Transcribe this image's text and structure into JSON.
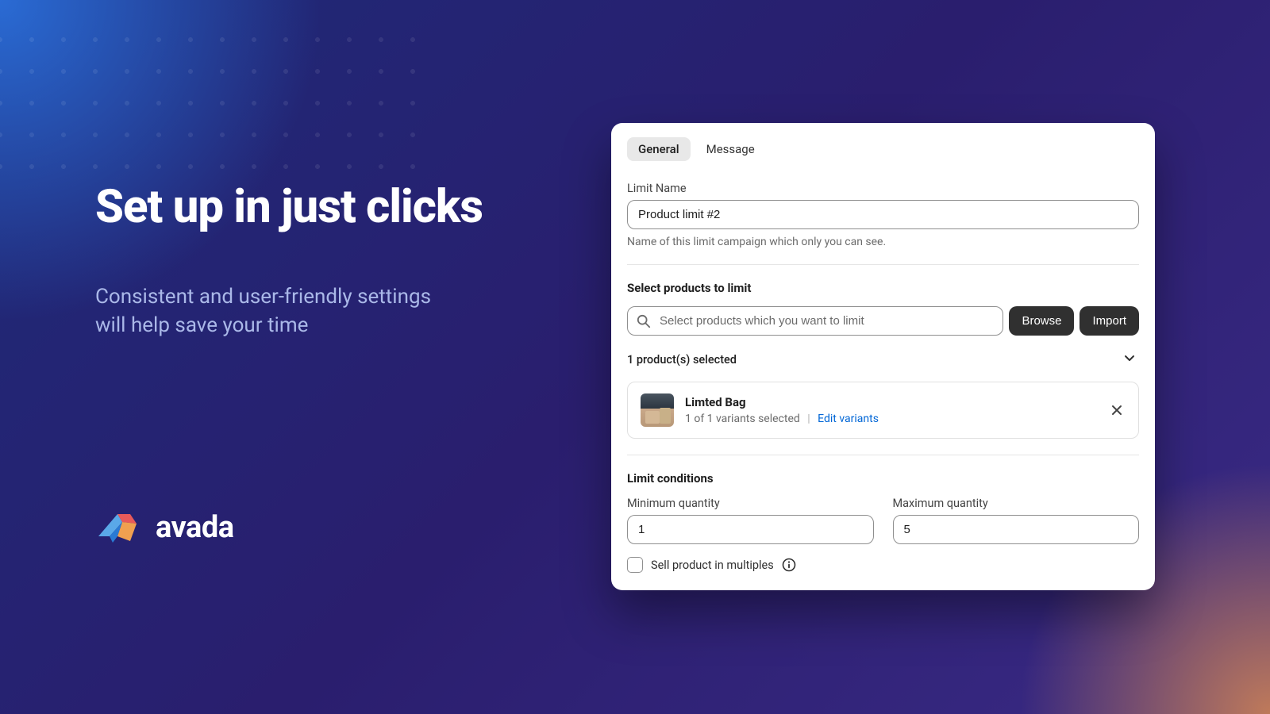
{
  "hero": {
    "title": "Set up in just clicks",
    "subtitle_line1": "Consistent and user-friendly settings",
    "subtitle_line2": "will help save your time"
  },
  "brand": {
    "name": "avada"
  },
  "card": {
    "tabs": {
      "general": "General",
      "message": "Message"
    },
    "limit_name": {
      "label": "Limit Name",
      "value": "Product limit #2",
      "help": "Name of this limit campaign which only you can see."
    },
    "select_products": {
      "title": "Select products to limit",
      "search_placeholder": "Select products which you want to limit",
      "browse": "Browse",
      "import": "Import",
      "count_text": "1 product(s) selected"
    },
    "product": {
      "name": "Limted Bag",
      "variants_text": "1 of 1 variants selected",
      "edit_link": "Edit variants"
    },
    "conditions": {
      "title": "Limit conditions",
      "min_label": "Minimum quantity",
      "min_value": "1",
      "max_label": "Maximum quantity",
      "max_value": "5",
      "multiples_label": "Sell product in multiples"
    }
  }
}
